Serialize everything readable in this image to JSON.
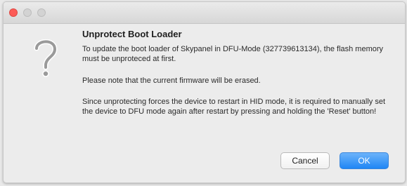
{
  "dialog": {
    "heading": "Unprotect Boot Loader",
    "paragraphs": [
      "To update the boot loader of Skypanel in DFU-Mode (327739613134), the flash memory must be unproteced at first.",
      "Please note that the current firmware will be erased.",
      "Since unprotecting forces the device to restart in HID mode, it is required to manually set the device to DFU mode again after restart by pressing and holding the 'Reset' button!"
    ],
    "icon": "question-mark-icon"
  },
  "buttons": {
    "cancel_label": "Cancel",
    "ok_label": "OK"
  },
  "colors": {
    "close_light": "#fc5b57",
    "accent": "#1f86f5"
  }
}
